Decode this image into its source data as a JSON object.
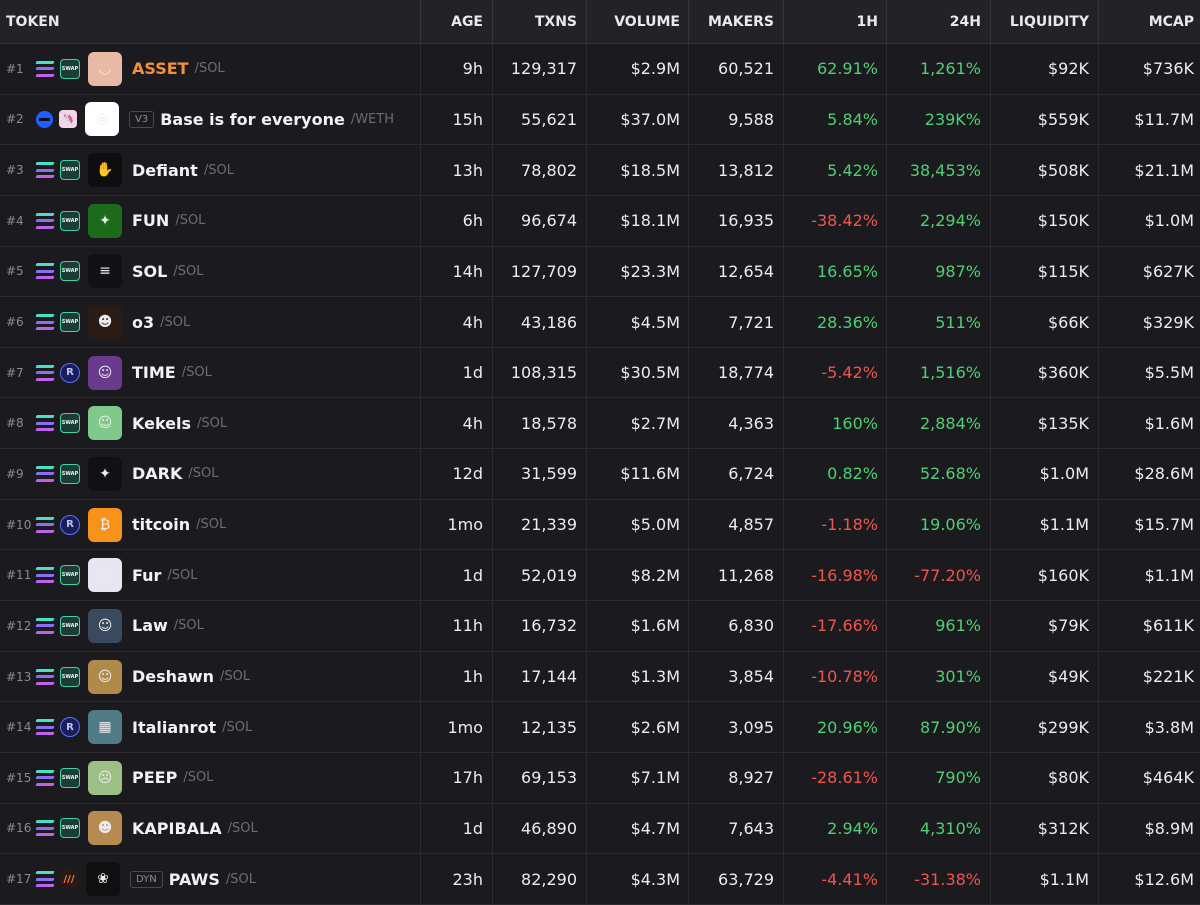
{
  "header": {
    "token": "TOKEN",
    "age": "AGE",
    "txns": "TXNS",
    "volume": "VOLUME",
    "makers": "MAKERS",
    "h1": "1H",
    "h24": "24H",
    "liquidity": "LIQUIDITY",
    "mcap": "MCAP"
  },
  "colors": {
    "positive": "#4fcf73",
    "negative": "#f0544f",
    "highlight": "#f3913a"
  },
  "rows": [
    {
      "rank": "#1",
      "chain": "solana-icon",
      "dex": "swap",
      "dex_label": "SWAP",
      "avatar_color": "#e8b9a4",
      "avatar_glyph": "◡",
      "badge": "",
      "name": "ASSET",
      "quote": "/SOL",
      "age": "9h",
      "txns": "129,317",
      "volume": "$2.9M",
      "makers": "60,521",
      "h1": "62.91%",
      "h24": "1,261%",
      "liquidity": "$92K",
      "mcap": "$736K",
      "h1_dir": "pos",
      "h24_dir": "pos",
      "hot": true
    },
    {
      "rank": "#2",
      "chain": "base-icon",
      "dex": "uni",
      "dex_label": "🦄",
      "avatar_color": "#ffffff",
      "avatar_glyph": "◎",
      "badge": "V3",
      "name": "Base is for everyone",
      "quote": "/WETH",
      "age": "15h",
      "txns": "55,621",
      "volume": "$37.0M",
      "makers": "9,588",
      "h1": "5.84%",
      "h24": "239K%",
      "liquidity": "$559K",
      "mcap": "$11.7M",
      "h1_dir": "pos",
      "h24_dir": "pos",
      "hot": false
    },
    {
      "rank": "#3",
      "chain": "solana-icon",
      "dex": "swap",
      "dex_label": "SWAP",
      "avatar_color": "#0e0e0e",
      "avatar_glyph": "✋",
      "badge": "",
      "name": "Defiant",
      "quote": "/SOL",
      "age": "13h",
      "txns": "78,802",
      "volume": "$18.5M",
      "makers": "13,812",
      "h1": "5.42%",
      "h24": "38,453%",
      "liquidity": "$508K",
      "mcap": "$21.1M",
      "h1_dir": "pos",
      "h24_dir": "pos",
      "hot": false
    },
    {
      "rank": "#4",
      "chain": "solana-icon",
      "dex": "swap",
      "dex_label": "SWAP",
      "avatar_color": "#1d6b1a",
      "avatar_glyph": "✦",
      "badge": "",
      "name": "FUN",
      "quote": "/SOL",
      "age": "6h",
      "txns": "96,674",
      "volume": "$18.1M",
      "makers": "16,935",
      "h1": "-38.42%",
      "h24": "2,294%",
      "liquidity": "$150K",
      "mcap": "$1.0M",
      "h1_dir": "neg",
      "h24_dir": "pos",
      "hot": false
    },
    {
      "rank": "#5",
      "chain": "solana-icon",
      "dex": "swap",
      "dex_label": "SWAP",
      "avatar_color": "#121216",
      "avatar_glyph": "≡",
      "badge": "",
      "name": "SOL",
      "quote": "/SOL",
      "age": "14h",
      "txns": "127,709",
      "volume": "$23.3M",
      "makers": "12,654",
      "h1": "16.65%",
      "h24": "987%",
      "liquidity": "$115K",
      "mcap": "$627K",
      "h1_dir": "pos",
      "h24_dir": "pos",
      "hot": false
    },
    {
      "rank": "#6",
      "chain": "solana-icon",
      "dex": "swap",
      "dex_label": "SWAP",
      "avatar_color": "#2a1c14",
      "avatar_glyph": "☻",
      "badge": "",
      "name": "o3",
      "quote": "/SOL",
      "age": "4h",
      "txns": "43,186",
      "volume": "$4.5M",
      "makers": "7,721",
      "h1": "28.36%",
      "h24": "511%",
      "liquidity": "$66K",
      "mcap": "$329K",
      "h1_dir": "pos",
      "h24_dir": "pos",
      "hot": false
    },
    {
      "rank": "#7",
      "chain": "solana-icon",
      "dex": "ray",
      "dex_label": "R",
      "avatar_color": "#6a3b8c",
      "avatar_glyph": "☺",
      "badge": "",
      "name": "TIME",
      "quote": "/SOL",
      "age": "1d",
      "txns": "108,315",
      "volume": "$30.5M",
      "makers": "18,774",
      "h1": "-5.42%",
      "h24": "1,516%",
      "liquidity": "$360K",
      "mcap": "$5.5M",
      "h1_dir": "neg",
      "h24_dir": "pos",
      "hot": false
    },
    {
      "rank": "#8",
      "chain": "solana-icon",
      "dex": "swap",
      "dex_label": "SWAP",
      "avatar_color": "#7fc98a",
      "avatar_glyph": "☺",
      "badge": "",
      "name": "Kekels",
      "quote": "/SOL",
      "age": "4h",
      "txns": "18,578",
      "volume": "$2.7M",
      "makers": "4,363",
      "h1": "160%",
      "h24": "2,884%",
      "liquidity": "$135K",
      "mcap": "$1.6M",
      "h1_dir": "pos",
      "h24_dir": "pos",
      "hot": false
    },
    {
      "rank": "#9",
      "chain": "solana-icon",
      "dex": "swap",
      "dex_label": "SWAP",
      "avatar_color": "#111114",
      "avatar_glyph": "✦",
      "badge": "",
      "name": "DARK",
      "quote": "/SOL",
      "age": "12d",
      "txns": "31,599",
      "volume": "$11.6M",
      "makers": "6,724",
      "h1": "0.82%",
      "h24": "52.68%",
      "liquidity": "$1.0M",
      "mcap": "$28.6M",
      "h1_dir": "pos",
      "h24_dir": "pos",
      "hot": false
    },
    {
      "rank": "#10",
      "chain": "solana-icon",
      "dex": "ray",
      "dex_label": "R",
      "avatar_color": "#f7931a",
      "avatar_glyph": "₿",
      "badge": "",
      "name": "titcoin",
      "quote": "/SOL",
      "age": "1mo",
      "txns": "21,339",
      "volume": "$5.0M",
      "makers": "4,857",
      "h1": "-1.18%",
      "h24": "19.06%",
      "liquidity": "$1.1M",
      "mcap": "$15.7M",
      "h1_dir": "neg",
      "h24_dir": "pos",
      "hot": false
    },
    {
      "rank": "#11",
      "chain": "solana-icon",
      "dex": "swap",
      "dex_label": "SWAP",
      "avatar_color": "#e9e6f2",
      "avatar_glyph": "≡",
      "badge": "",
      "name": "Fur",
      "quote": "/SOL",
      "age": "1d",
      "txns": "52,019",
      "volume": "$8.2M",
      "makers": "11,268",
      "h1": "-16.98%",
      "h24": "-77.20%",
      "liquidity": "$160K",
      "mcap": "$1.1M",
      "h1_dir": "neg",
      "h24_dir": "neg",
      "hot": false
    },
    {
      "rank": "#12",
      "chain": "solana-icon",
      "dex": "swap",
      "dex_label": "SWAP",
      "avatar_color": "#3a4a5e",
      "avatar_glyph": "☺",
      "badge": "",
      "name": "Law",
      "quote": "/SOL",
      "age": "11h",
      "txns": "16,732",
      "volume": "$1.6M",
      "makers": "6,830",
      "h1": "-17.66%",
      "h24": "961%",
      "liquidity": "$79K",
      "mcap": "$611K",
      "h1_dir": "neg",
      "h24_dir": "pos",
      "hot": false
    },
    {
      "rank": "#13",
      "chain": "solana-icon",
      "dex": "swap",
      "dex_label": "SWAP",
      "avatar_color": "#b08a4a",
      "avatar_glyph": "☺",
      "badge": "",
      "name": "Deshawn",
      "quote": "/SOL",
      "age": "1h",
      "txns": "17,144",
      "volume": "$1.3M",
      "makers": "3,854",
      "h1": "-10.78%",
      "h24": "301%",
      "liquidity": "$49K",
      "mcap": "$221K",
      "h1_dir": "neg",
      "h24_dir": "pos",
      "hot": false
    },
    {
      "rank": "#14",
      "chain": "solana-icon",
      "dex": "ray",
      "dex_label": "R",
      "avatar_color": "#4f7a86",
      "avatar_glyph": "▦",
      "badge": "",
      "name": "Italianrot",
      "quote": "/SOL",
      "age": "1mo",
      "txns": "12,135",
      "volume": "$2.6M",
      "makers": "3,095",
      "h1": "20.96%",
      "h24": "87.90%",
      "liquidity": "$299K",
      "mcap": "$3.8M",
      "h1_dir": "pos",
      "h24_dir": "pos",
      "hot": false
    },
    {
      "rank": "#15",
      "chain": "solana-icon",
      "dex": "swap",
      "dex_label": "SWAP",
      "avatar_color": "#9cbf86",
      "avatar_glyph": "☹",
      "badge": "",
      "name": "PEEP",
      "quote": "/SOL",
      "age": "17h",
      "txns": "69,153",
      "volume": "$7.1M",
      "makers": "8,927",
      "h1": "-28.61%",
      "h24": "790%",
      "liquidity": "$80K",
      "mcap": "$464K",
      "h1_dir": "neg",
      "h24_dir": "pos",
      "hot": false
    },
    {
      "rank": "#16",
      "chain": "solana-icon",
      "dex": "swap",
      "dex_label": "SWAP",
      "avatar_color": "#b78a52",
      "avatar_glyph": "☻",
      "badge": "",
      "name": "KAPIBALA",
      "quote": "/SOL",
      "age": "1d",
      "txns": "46,890",
      "volume": "$4.7M",
      "makers": "7,643",
      "h1": "2.94%",
      "h24": "4,310%",
      "liquidity": "$312K",
      "mcap": "$8.9M",
      "h1_dir": "pos",
      "h24_dir": "pos",
      "hot": false
    },
    {
      "rank": "#17",
      "chain": "solana-icon",
      "dex": "met",
      "dex_label": "///",
      "avatar_color": "#0f0f10",
      "avatar_glyph": "❀",
      "badge": "DYN",
      "name": "PAWS",
      "quote": "/SOL",
      "age": "23h",
      "txns": "82,290",
      "volume": "$4.3M",
      "makers": "63,729",
      "h1": "-4.41%",
      "h24": "-31.38%",
      "liquidity": "$1.1M",
      "mcap": "$12.6M",
      "h1_dir": "neg",
      "h24_dir": "neg",
      "hot": false
    }
  ]
}
